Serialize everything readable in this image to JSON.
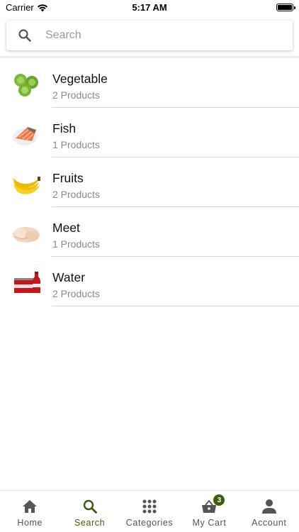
{
  "status_bar": {
    "carrier": "Carrier",
    "time": "5:17 AM"
  },
  "search": {
    "placeholder": "Search"
  },
  "categories": [
    {
      "name": "Vegetable",
      "count": "2 Products",
      "image": "brussels-sprouts"
    },
    {
      "name": "Fish",
      "count": "1 Products",
      "image": "salmon-fillet"
    },
    {
      "name": "Fruits",
      "count": "2 Products",
      "image": "bananas"
    },
    {
      "name": "Meet",
      "count": "1 Products",
      "image": "raw-chicken"
    },
    {
      "name": "Water",
      "count": "2 Products",
      "image": "soda-bottles"
    }
  ],
  "nav": {
    "home": "Home",
    "search": "Search",
    "categories": "Categories",
    "cart": "My Cart",
    "cart_badge": "3",
    "account": "Account"
  },
  "colors": {
    "accent": "#3d5c0f",
    "inactive": "#555555"
  }
}
